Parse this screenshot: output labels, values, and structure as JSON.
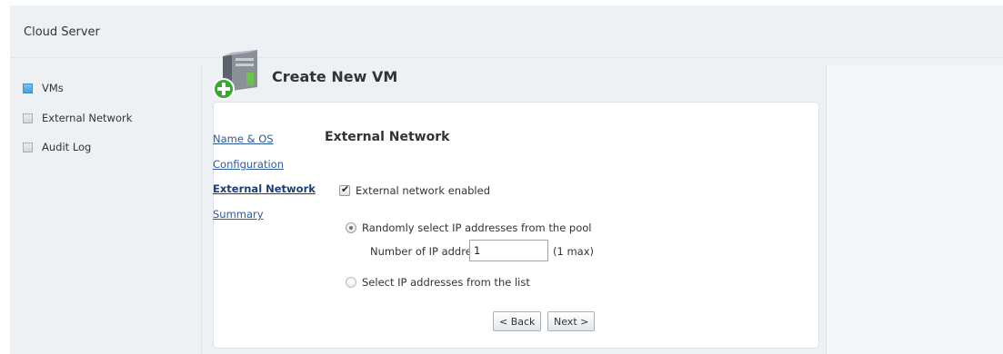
{
  "app": {
    "title": "Cloud Server"
  },
  "nav": {
    "items": [
      {
        "label": "VMs",
        "selected": true
      },
      {
        "label": "External Network",
        "selected": false
      },
      {
        "label": "Audit Log",
        "selected": false
      }
    ]
  },
  "page": {
    "title": "Create New VM"
  },
  "wizard": {
    "steps": [
      {
        "label": "Name & OS",
        "active": false
      },
      {
        "label": "Configuration",
        "active": false
      },
      {
        "label": "External Network",
        "active": true
      },
      {
        "label": "Summary",
        "active": false
      }
    ]
  },
  "section": {
    "title": "External Network"
  },
  "form": {
    "external_enabled_label": "External network enabled",
    "external_enabled": true,
    "random_label": "Randomly select IP addresses from the pool",
    "random_selected": true,
    "count_label": "Number of IP addresses:",
    "count_value": "1",
    "max_note": "(1 max)",
    "list_label": "Select IP addresses from the list",
    "list_selected": false
  },
  "buttons": {
    "back": "< Back",
    "next": "Next >"
  },
  "icons": {
    "vm": "server-icon",
    "add": "plus-circle-icon"
  },
  "colors": {
    "link": "#2b5a9e",
    "selected_nav": "#3d9de4",
    "add_badge": "#3fa535"
  }
}
